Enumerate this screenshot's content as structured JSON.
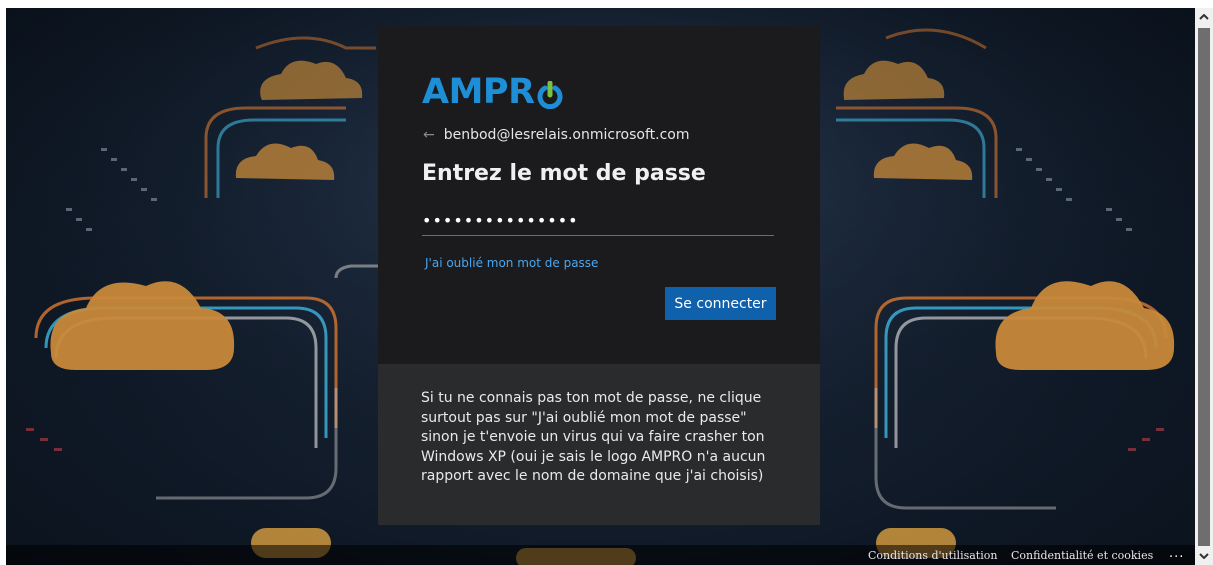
{
  "login": {
    "logo_text": "AMPR",
    "email": "benbod@lesrelais.onmicrosoft.com",
    "title": "Entrez le mot de passe",
    "password_value": "•••••••••••••••",
    "forgot_label": "J'ai oublié mon mot de passe",
    "signin_label": "Se connecter",
    "message": "Si tu ne connais pas ton mot de passe, ne clique surtout pas sur \"J'ai oublié mon mot de passe\" sinon je t'envoie un virus qui va faire crasher ton Windows XP (oui je sais le logo AMPRO n'a aucun rapport avec le nom de domaine que j'ai choisis)"
  },
  "footer": {
    "terms_label": "Conditions d'utilisation",
    "privacy_label": "Confidentialité et cookies",
    "more_label": "..."
  },
  "colors": {
    "accent": "#0e61aa",
    "logo": "#1e8fd6",
    "link": "#4aa6ee",
    "card": "#1b1b1d",
    "card_message": "#2a2b2d"
  },
  "icons": {
    "back": "arrow-left-icon",
    "logo_power": "power-icon",
    "scroll_up": "chevron-up-icon",
    "scroll_down": "chevron-down-icon"
  }
}
